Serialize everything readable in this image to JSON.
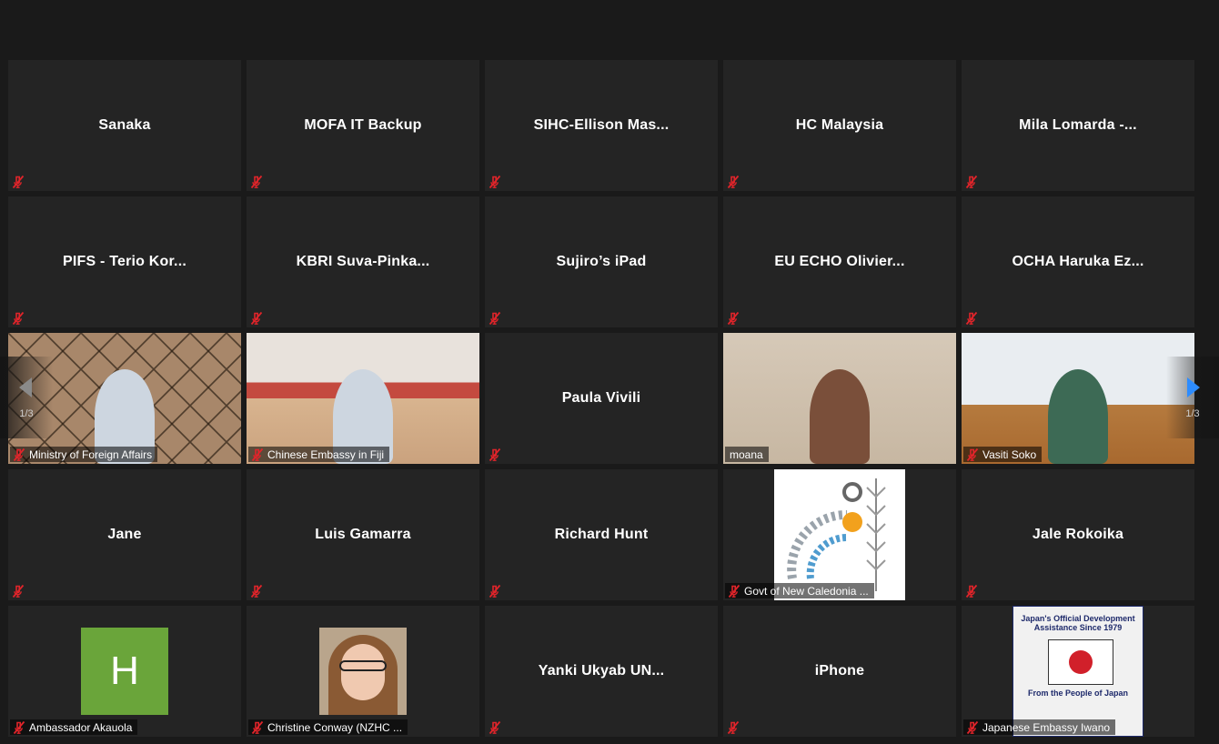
{
  "participants": [
    {
      "name": "Sanaka",
      "type": "name"
    },
    {
      "name": "MOFA IT Backup",
      "type": "name"
    },
    {
      "name": "SIHC-Ellison  Mas...",
      "type": "name"
    },
    {
      "name": "HC Malaysia",
      "type": "name"
    },
    {
      "name": "Mila  Lomarda  -...",
      "type": "name"
    },
    {
      "name": "PIFS  -  Terio  Kor...",
      "type": "name"
    },
    {
      "name": "KBRI  Suva-Pinka...",
      "type": "name"
    },
    {
      "name": "Sujiro’s iPad",
      "type": "name"
    },
    {
      "name": "EU  ECHO  Olivier...",
      "type": "name"
    },
    {
      "name": "OCHA  Haruka  Ez...",
      "type": "name"
    },
    {
      "name": "Ministry of Foreign Affairs",
      "type": "video",
      "video": "fiji"
    },
    {
      "name": "Chinese Embassy in Fiji",
      "type": "video",
      "video": "china"
    },
    {
      "name": "Paula  Vivili",
      "type": "name"
    },
    {
      "name": "moana",
      "type": "video",
      "video": "moana",
      "active": true
    },
    {
      "name": "Vasiti Soko",
      "type": "video",
      "video": "vasiti"
    },
    {
      "name": "Jane",
      "type": "name"
    },
    {
      "name": "Luis  Gamarra",
      "type": "name"
    },
    {
      "name": "Richard  Hunt",
      "type": "name"
    },
    {
      "name": "Govt of New Caledonia ...",
      "type": "logo",
      "video": "newcaledonia"
    },
    {
      "name": "Jale  Rokoika",
      "type": "name"
    },
    {
      "name": "Ambassador Akauola",
      "type": "avatar",
      "initial": "H"
    },
    {
      "name": "Christine Conway (NZHC ...",
      "type": "photo"
    },
    {
      "name": "Yanki  Ukyab  UN...",
      "type": "name"
    },
    {
      "name": "iPhone",
      "type": "name"
    },
    {
      "name": "Japanese Embassy Iwano",
      "type": "japan"
    }
  ],
  "japan_card": {
    "top_text": "Japan's Official Development Assistance Since 1979",
    "bottom_text": "From the People of Japan"
  },
  "navigation": {
    "left_page": "1/3",
    "right_page": "1/3"
  },
  "colors": {
    "background": "#1a1a1a",
    "tile": "#242424",
    "active_border": "#c9d85a",
    "mute_icon": "#e0242a",
    "avatar": "#6aa53a",
    "nav_arrow_right": "#2d8cff"
  }
}
